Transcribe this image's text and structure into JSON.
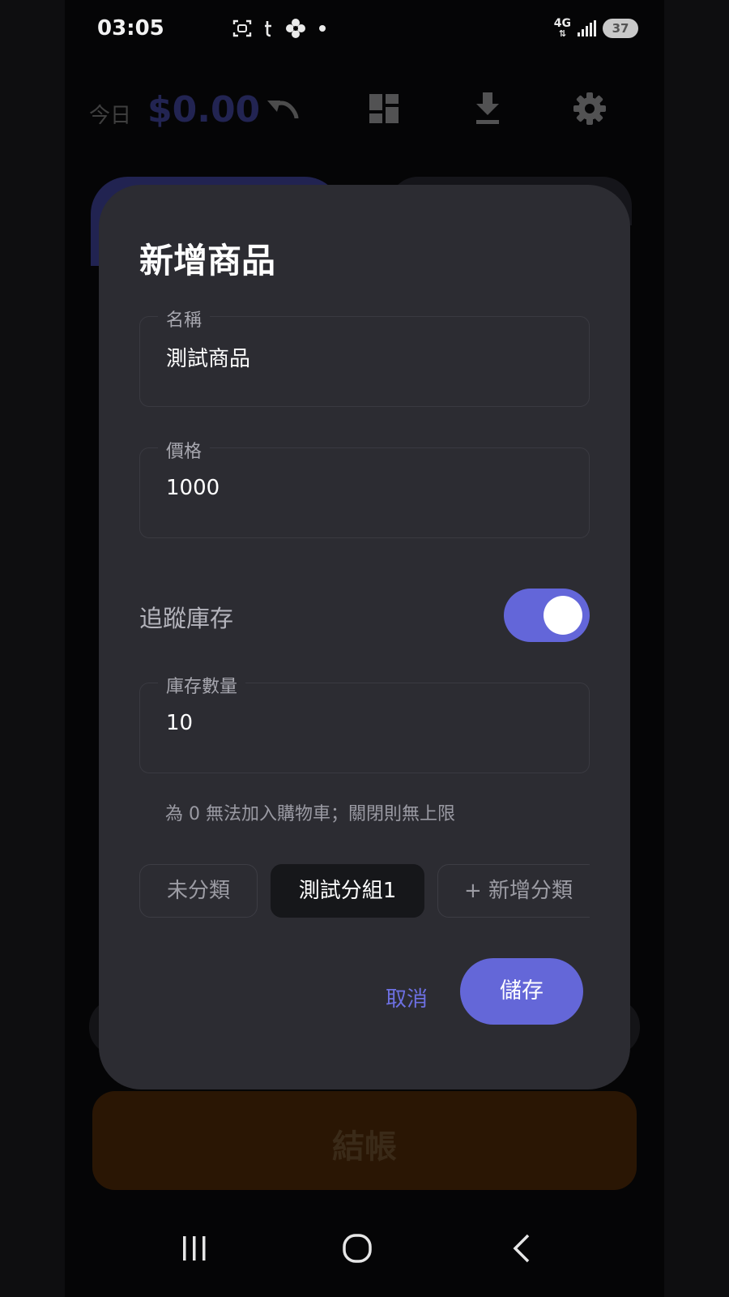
{
  "status_bar": {
    "time": "03:05",
    "network": "4G",
    "battery": "37",
    "icons": [
      "screenshot-icon",
      "t-app-icon",
      "pinwheel-icon",
      "dot-icon",
      "signal-icon",
      "battery-icon"
    ]
  },
  "app_bar": {
    "today_label": "今日",
    "today_amount": "$0.00",
    "icons": [
      "undo-icon",
      "dashboard-icon",
      "download-icon",
      "gear-icon"
    ]
  },
  "checkout": {
    "label": "結帳"
  },
  "dialog": {
    "title": "新增商品",
    "name_field": {
      "label": "名稱",
      "value": "測試商品"
    },
    "price_field": {
      "label": "價格",
      "value": "1000"
    },
    "track_inventory": {
      "label": "追蹤庫存",
      "enabled": true
    },
    "stock_field": {
      "label": "庫存數量",
      "value": "10"
    },
    "stock_helper": "為 0 無法加入購物車；關閉則無上限",
    "categories": {
      "uncategorized": "未分類",
      "selected_group": "測試分組1",
      "add_category": "+ 新增分類"
    },
    "cancel_label": "取消",
    "save_label": "儲存"
  },
  "colors": {
    "accent": "#6366d9",
    "dialog_bg": "#2c2c32",
    "selected_chip_bg": "#16171a",
    "checkout_bg": "#2a1604"
  },
  "nav_bar": {
    "icons": [
      "recent-apps-icon",
      "home-icon",
      "back-icon"
    ]
  }
}
